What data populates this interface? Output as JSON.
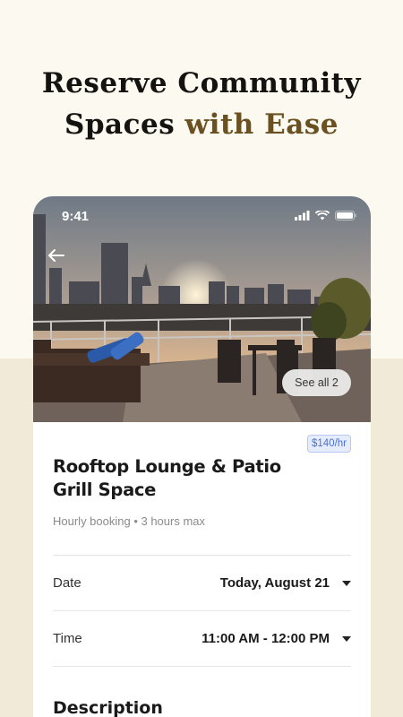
{
  "headline": {
    "line1": "Reserve Community",
    "line2_plain": "Spaces ",
    "line2_accent": "with Ease"
  },
  "status_bar": {
    "time": "9:41"
  },
  "hero": {
    "see_all_label": "See all 2"
  },
  "listing": {
    "price_badge": "$140/hr",
    "title": "Rooftop Lounge & Patio Grill Space",
    "subtitle": "Hourly booking • 3 hours max"
  },
  "booking": {
    "date": {
      "label": "Date",
      "value": "Today, August 21"
    },
    "time": {
      "label": "Time",
      "value": "11:00 AM - 12:00 PM"
    }
  },
  "description": {
    "heading": "Description"
  },
  "colors": {
    "accent": "#6b5020",
    "badge_text": "#4a6fd8",
    "background": "#fcf9f1"
  }
}
